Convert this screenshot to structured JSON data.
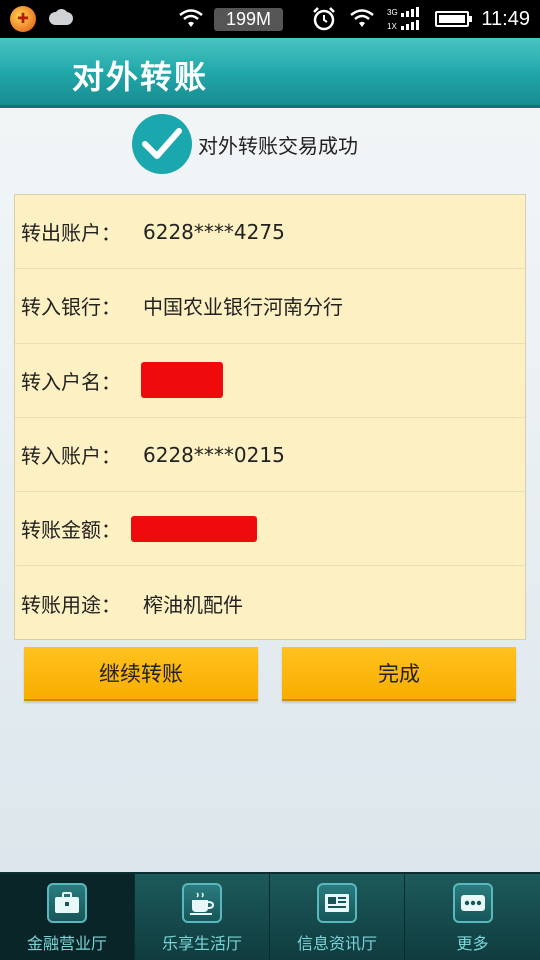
{
  "status_bar": {
    "memory": "199M",
    "time": "11:49",
    "network_label": "3G 1X"
  },
  "header": {
    "title": "对外转账"
  },
  "result": {
    "message": "对外转账交易成功"
  },
  "details": [
    {
      "label": "转出账户：",
      "value": "6228****4275"
    },
    {
      "label": "转入银行：",
      "value": "中国农业银行河南分行"
    },
    {
      "label": "转入户名：",
      "value": ""
    },
    {
      "label": "转入账户：",
      "value": "6228****0215"
    },
    {
      "label": "转账金额：",
      "value": ""
    },
    {
      "label": "转账用途：",
      "value": "榨油机配件"
    }
  ],
  "buttons": {
    "continue_label": "继续转账",
    "done_label": "完成"
  },
  "colors": {
    "header_accent": "#22a8aa",
    "button": "#f8ad00",
    "panel": "#fdf0c3",
    "redaction": "#ef0b0b"
  },
  "bottom_nav": [
    {
      "label": "金融营业厅",
      "icon": "briefcase-icon",
      "active": true
    },
    {
      "label": "乐享生活厅",
      "icon": "coffee-cup-icon",
      "active": false
    },
    {
      "label": "信息资讯厅",
      "icon": "newspaper-icon",
      "active": false
    },
    {
      "label": "更多",
      "icon": "more-dots-icon",
      "active": false
    }
  ]
}
